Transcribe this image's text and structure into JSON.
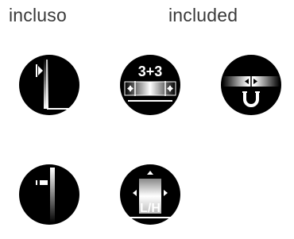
{
  "labels": {
    "italian": "incluso",
    "english": "included"
  },
  "icons": [
    {
      "name": "fence-vertical-icon"
    },
    {
      "name": "three-plus-three-icon",
      "text": "3+3"
    },
    {
      "name": "magnet-adjust-icon"
    },
    {
      "name": "vertical-bar-icon"
    },
    {
      "name": "lh-adjust-icon",
      "text": "L/H"
    }
  ],
  "colors": {
    "text": "#3a3a3a",
    "icon_fill": "#000000",
    "icon_detail": "#ffffff"
  }
}
